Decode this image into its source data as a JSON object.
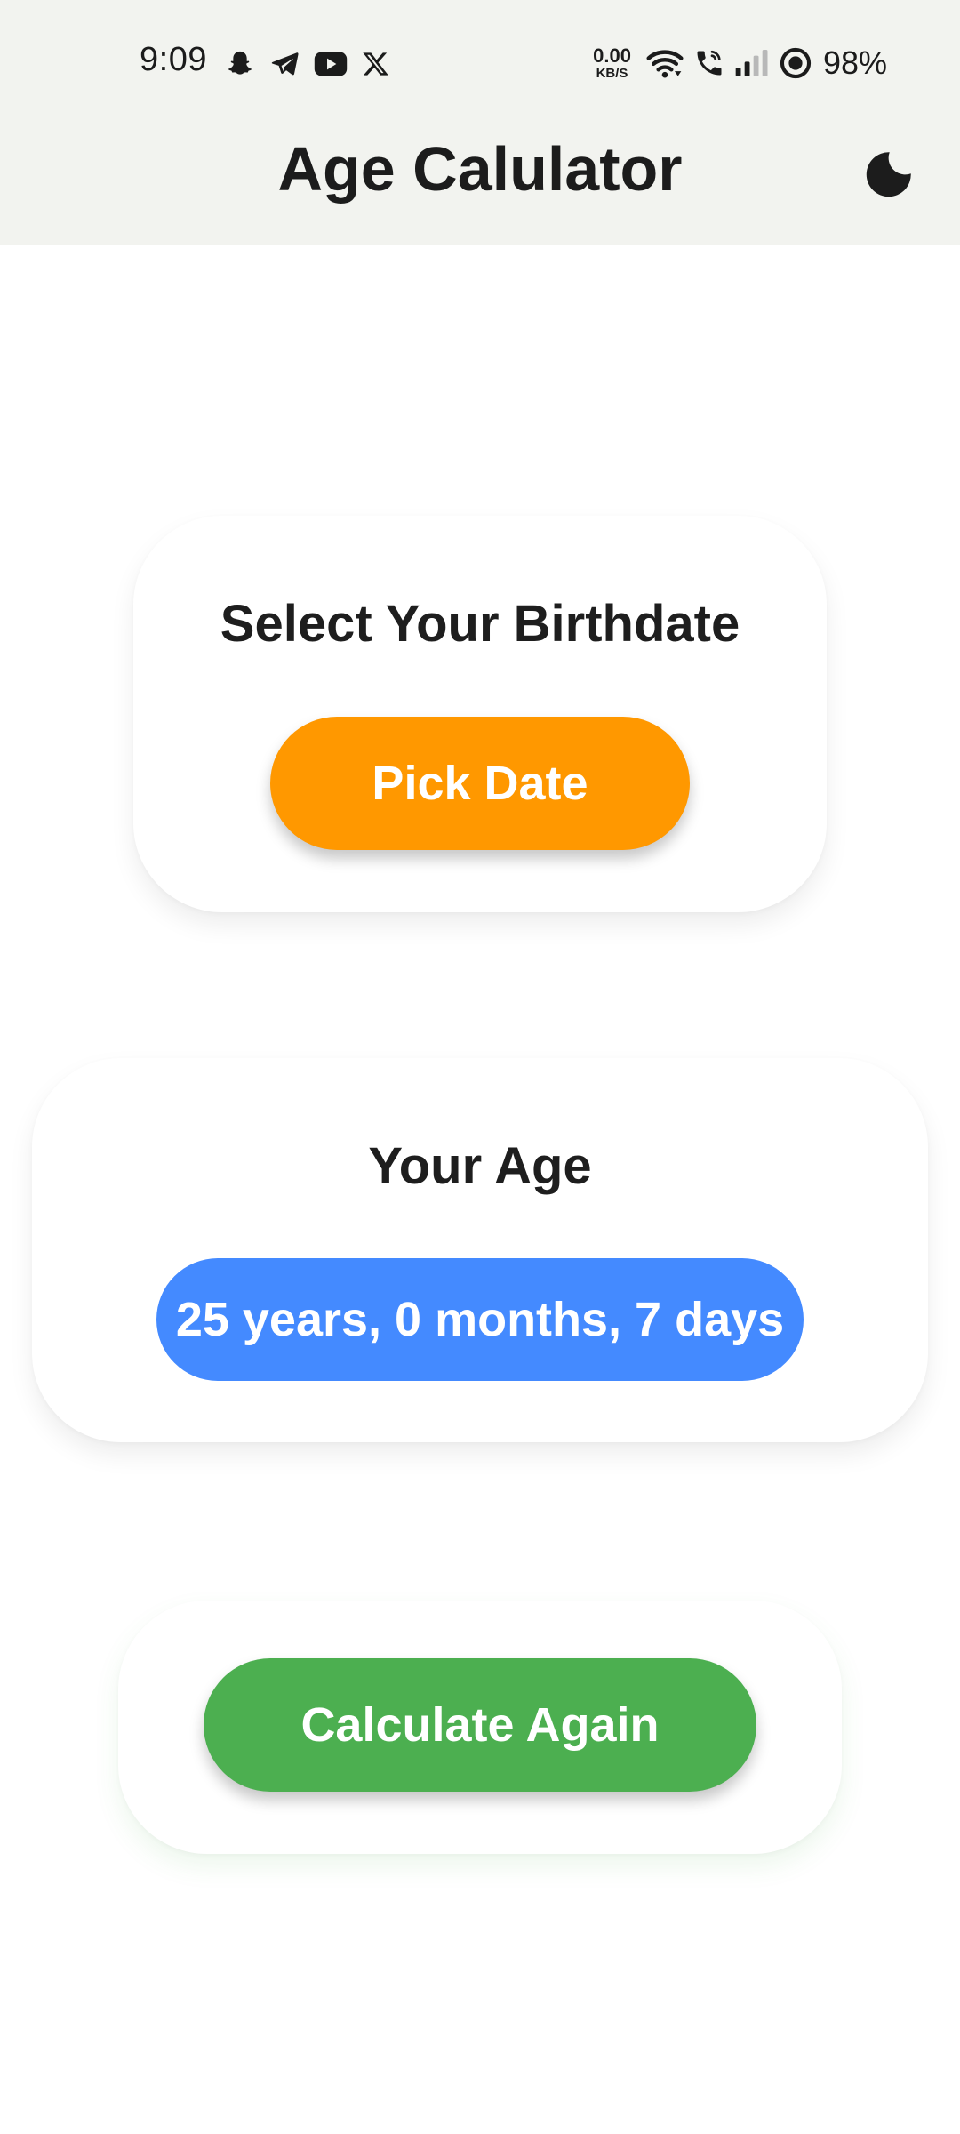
{
  "status_bar": {
    "time": "9:09",
    "left_icons": [
      "snapchat-icon",
      "telegram-icon",
      "youtube-icon",
      "x-icon"
    ],
    "net_speed_value": "0.00",
    "net_speed_unit": "KB/S",
    "right_icons": [
      "wifi-icon",
      "wifi-call-icon",
      "signal-icon",
      "ring-icon"
    ],
    "battery": "98%"
  },
  "app_bar": {
    "title": "Age Calulator",
    "theme_icon": "moon-icon"
  },
  "birth_card": {
    "heading": "Select Your Birthdate",
    "button_label": "Pick Date"
  },
  "age_card": {
    "heading": "Your Age",
    "result": "25 years, 0 months, 7 days"
  },
  "again_card": {
    "button_label": "Calculate Again"
  },
  "colors": {
    "header_bg": "#f2f3ef",
    "pick_button": "#ff9800",
    "age_pill": "#448aff",
    "again_button": "#4caf50",
    "text_dark": "#1c1c1c"
  }
}
